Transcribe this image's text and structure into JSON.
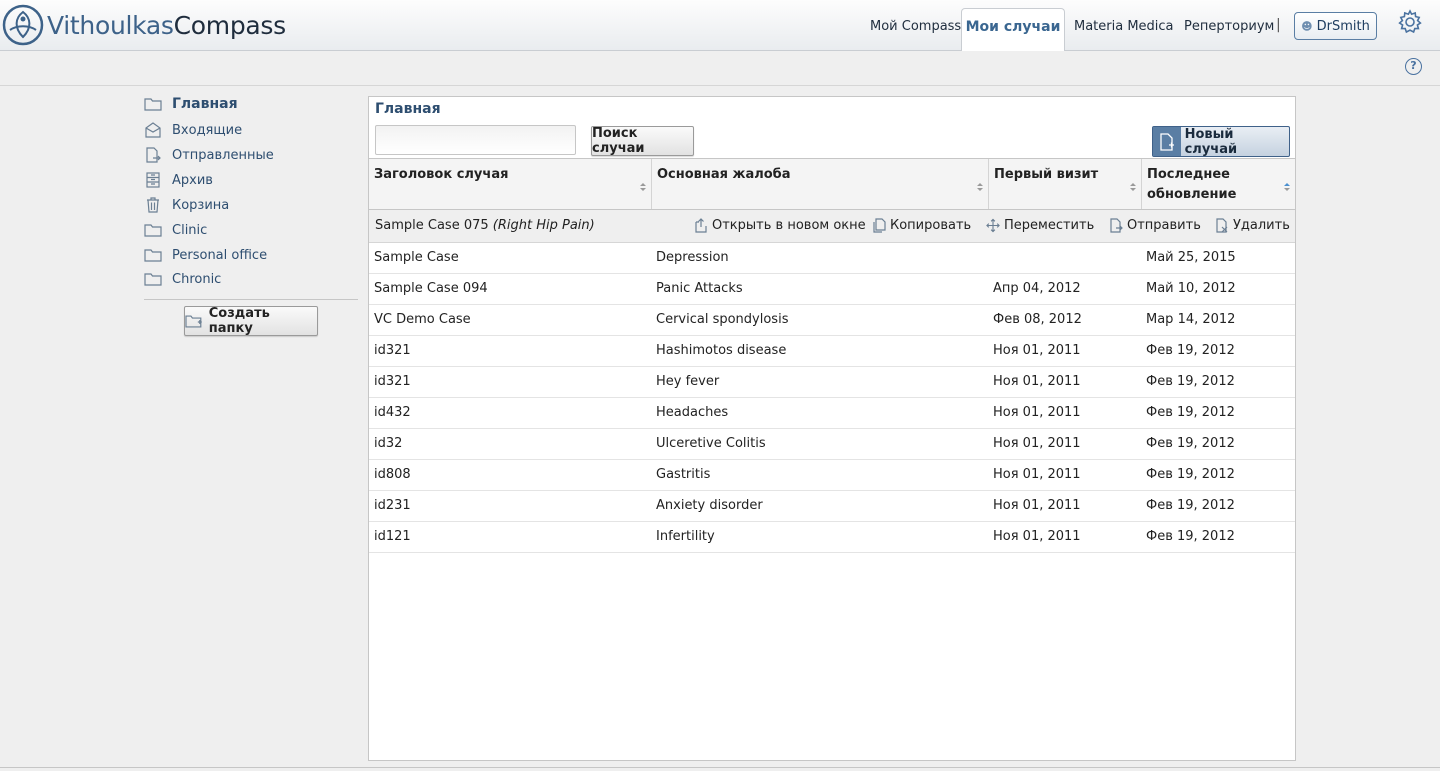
{
  "brand": {
    "part1": "Vithoulkas",
    "part2": "Compass"
  },
  "nav": {
    "items": [
      "Мой Compass",
      "Мои случаи",
      "Materia Medica",
      "Реперториум"
    ],
    "active": "Мои случаи",
    "separator": "|",
    "user": "DrSmith"
  },
  "help": {
    "label": "?"
  },
  "sidebar": {
    "items": [
      {
        "label": "Главная",
        "icon": "folder-icon"
      },
      {
        "label": "Входящие",
        "icon": "inbox-icon"
      },
      {
        "label": "Отправленные",
        "icon": "sent-icon"
      },
      {
        "label": "Архив",
        "icon": "archive-icon"
      },
      {
        "label": "Корзина",
        "icon": "trash-icon"
      },
      {
        "label": "Clinic",
        "icon": "folder-icon"
      },
      {
        "label": "Personal office",
        "icon": "folder-icon"
      },
      {
        "label": "Chronic",
        "icon": "folder-icon"
      }
    ],
    "create_folder": "Создать папку"
  },
  "main": {
    "title": "Главная",
    "search": {
      "value": "",
      "placeholder": "",
      "button": "Поиск случаи"
    },
    "new_case": "Новый случай",
    "columns": [
      "Заголовок случая",
      "Основная жалоба",
      "Первый визит",
      "Последнее обновление"
    ],
    "selected": {
      "title": "Sample Case 075",
      "complaint": "(Right Hip Pain)",
      "actions": [
        "Открыть в новом окне",
        "Копировать",
        "Переместить",
        "Отправить",
        "Удалить"
      ]
    },
    "rows": [
      {
        "title": "Sample Case",
        "complaint": "Depression",
        "first": "",
        "updated": "Май 25, 2015"
      },
      {
        "title": "Sample Case 094",
        "complaint": "Panic Attacks",
        "first": "Апр 04, 2012",
        "updated": "Май 10, 2012"
      },
      {
        "title": "VC Demo Case",
        "complaint": "Cervical spondylosis",
        "first": "Фев 08, 2012",
        "updated": "Мар 14, 2012"
      },
      {
        "title": "id321",
        "complaint": "Hashimotos disease",
        "first": "Ноя 01, 2011",
        "updated": "Фев 19, 2012"
      },
      {
        "title": "id321",
        "complaint": "Hey fever",
        "first": "Ноя 01, 2011",
        "updated": "Фев 19, 2012"
      },
      {
        "title": "id432",
        "complaint": "Headaches",
        "first": "Ноя 01, 2011",
        "updated": "Фев 19, 2012"
      },
      {
        "title": "id32",
        "complaint": "Ulceretive Colitis",
        "first": "Ноя 01, 2011",
        "updated": "Фев 19, 2012"
      },
      {
        "title": "id808",
        "complaint": "Gastritis",
        "first": "Ноя 01, 2011",
        "updated": "Фев 19, 2012"
      },
      {
        "title": "id231",
        "complaint": "Anxiety disorder",
        "first": "Ноя 01, 2011",
        "updated": "Фев 19, 2012"
      },
      {
        "title": "id121",
        "complaint": "Infertility",
        "first": "Ноя 01, 2011",
        "updated": "Фев 19, 2012"
      }
    ]
  },
  "colors": {
    "accent": "#2e4e70",
    "brand_blue": "#3d6289",
    "button_blue": "#5a7ea4"
  }
}
